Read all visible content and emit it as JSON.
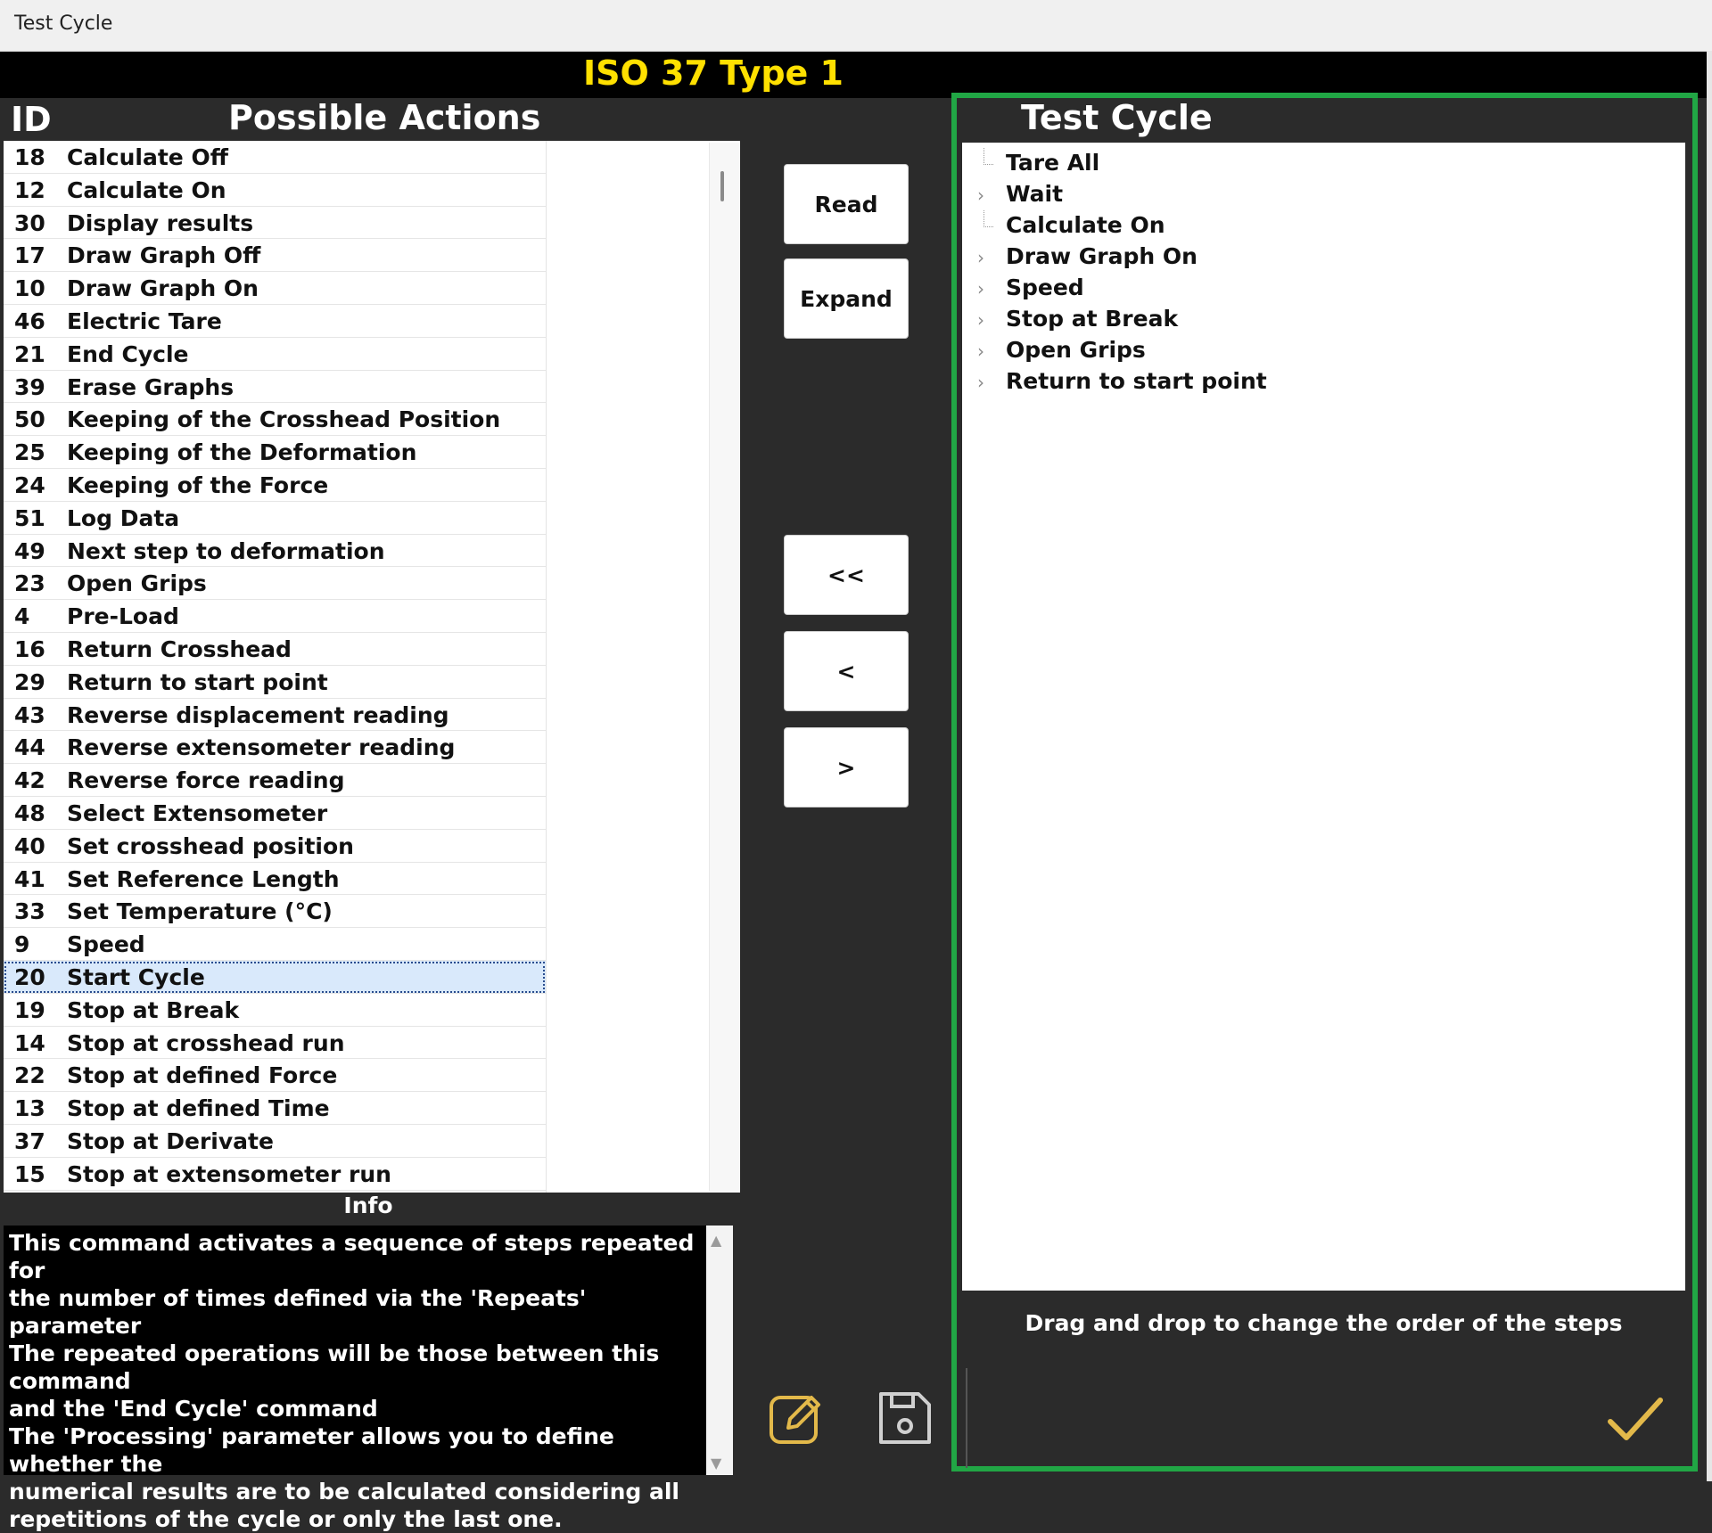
{
  "window": {
    "title": "Test Cycle"
  },
  "header": {
    "title": "ISO 37 Type 1"
  },
  "actions": {
    "id_heading": "ID",
    "name_heading": "Possible Actions",
    "items": [
      {
        "id": "18",
        "name": "Calculate Off"
      },
      {
        "id": "12",
        "name": "Calculate On"
      },
      {
        "id": "30",
        "name": "Display results"
      },
      {
        "id": "17",
        "name": "Draw Graph Off"
      },
      {
        "id": "10",
        "name": "Draw Graph On"
      },
      {
        "id": "46",
        "name": "Electric Tare"
      },
      {
        "id": "21",
        "name": "End Cycle"
      },
      {
        "id": "39",
        "name": "Erase Graphs"
      },
      {
        "id": "50",
        "name": "Keeping of the Crosshead Position"
      },
      {
        "id": "25",
        "name": "Keeping of the Deformation"
      },
      {
        "id": "24",
        "name": "Keeping of the Force"
      },
      {
        "id": "51",
        "name": "Log Data"
      },
      {
        "id": "49",
        "name": "Next step to deformation"
      },
      {
        "id": "23",
        "name": "Open Grips"
      },
      {
        "id": "4",
        "name": "Pre-Load"
      },
      {
        "id": "16",
        "name": "Return Crosshead"
      },
      {
        "id": "29",
        "name": "Return to start point"
      },
      {
        "id": "43",
        "name": "Reverse displacement reading"
      },
      {
        "id": "44",
        "name": "Reverse extensometer reading"
      },
      {
        "id": "42",
        "name": "Reverse force reading"
      },
      {
        "id": "48",
        "name": "Select Extensometer"
      },
      {
        "id": "40",
        "name": "Set crosshead position"
      },
      {
        "id": "41",
        "name": "Set Reference Length"
      },
      {
        "id": "33",
        "name": "Set Temperature (°C)"
      },
      {
        "id": "9",
        "name": "Speed"
      },
      {
        "id": "20",
        "name": "Start Cycle",
        "selected": true
      },
      {
        "id": "19",
        "name": "Stop at Break"
      },
      {
        "id": "14",
        "name": "Stop at crosshead run"
      },
      {
        "id": "22",
        "name": "Stop at defined Force"
      },
      {
        "id": "13",
        "name": "Stop at defined Time"
      },
      {
        "id": "37",
        "name": "Stop at Derivate"
      },
      {
        "id": "15",
        "name": "Stop at extensometer run"
      }
    ]
  },
  "info": {
    "heading": "Info",
    "text": "This command activates a sequence of steps repeated for\nthe number of times defined via the 'Repeats' parameter\nThe repeated operations will be those between this command\nand the 'End Cycle' command\nThe 'Processing' parameter allows you to define whether the\nnumerical results are to be calculated considering all\nrepetitions of the cycle or only the last one."
  },
  "buttons": {
    "read": "Read",
    "expand": "Expand",
    "remove_all": "<<",
    "remove": "<",
    "add": ">"
  },
  "cycle": {
    "heading": "Test Cycle",
    "items": [
      {
        "label": "Tare All",
        "expandable": false
      },
      {
        "label": "Wait",
        "expandable": true
      },
      {
        "label": "Calculate On",
        "expandable": false
      },
      {
        "label": "Draw Graph On",
        "expandable": true
      },
      {
        "label": "Speed",
        "expandable": true
      },
      {
        "label": "Stop at Break",
        "expandable": true
      },
      {
        "label": "Open Grips",
        "expandable": true
      },
      {
        "label": "Return to start point",
        "expandable": true
      }
    ],
    "hint": "Drag and drop to change the order of the steps"
  },
  "icons": {
    "edit": "pencil-square-icon",
    "save": "floppy-disk-icon",
    "confirm": "checkmark-icon"
  },
  "colors": {
    "header_title": "#ffe000",
    "cycle_frame": "#21a645",
    "icon_gold": "#e3b94a"
  }
}
